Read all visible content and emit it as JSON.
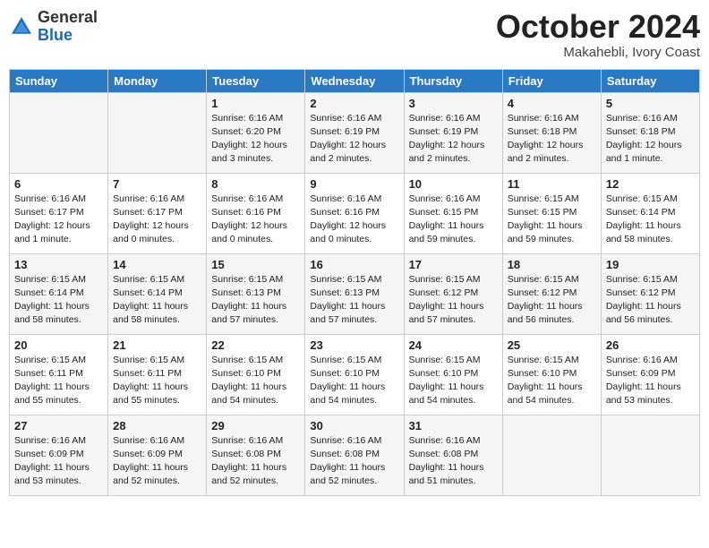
{
  "header": {
    "logo_general": "General",
    "logo_blue": "Blue",
    "month": "October 2024",
    "location": "Makahebli, Ivory Coast"
  },
  "days_of_week": [
    "Sunday",
    "Monday",
    "Tuesday",
    "Wednesday",
    "Thursday",
    "Friday",
    "Saturday"
  ],
  "weeks": [
    [
      {
        "day": "",
        "info": ""
      },
      {
        "day": "",
        "info": ""
      },
      {
        "day": "1",
        "info": "Sunrise: 6:16 AM\nSunset: 6:20 PM\nDaylight: 12 hours\nand 3 minutes."
      },
      {
        "day": "2",
        "info": "Sunrise: 6:16 AM\nSunset: 6:19 PM\nDaylight: 12 hours\nand 2 minutes."
      },
      {
        "day": "3",
        "info": "Sunrise: 6:16 AM\nSunset: 6:19 PM\nDaylight: 12 hours\nand 2 minutes."
      },
      {
        "day": "4",
        "info": "Sunrise: 6:16 AM\nSunset: 6:18 PM\nDaylight: 12 hours\nand 2 minutes."
      },
      {
        "day": "5",
        "info": "Sunrise: 6:16 AM\nSunset: 6:18 PM\nDaylight: 12 hours\nand 1 minute."
      }
    ],
    [
      {
        "day": "6",
        "info": "Sunrise: 6:16 AM\nSunset: 6:17 PM\nDaylight: 12 hours\nand 1 minute."
      },
      {
        "day": "7",
        "info": "Sunrise: 6:16 AM\nSunset: 6:17 PM\nDaylight: 12 hours\nand 0 minutes."
      },
      {
        "day": "8",
        "info": "Sunrise: 6:16 AM\nSunset: 6:16 PM\nDaylight: 12 hours\nand 0 minutes."
      },
      {
        "day": "9",
        "info": "Sunrise: 6:16 AM\nSunset: 6:16 PM\nDaylight: 12 hours\nand 0 minutes."
      },
      {
        "day": "10",
        "info": "Sunrise: 6:16 AM\nSunset: 6:15 PM\nDaylight: 11 hours\nand 59 minutes."
      },
      {
        "day": "11",
        "info": "Sunrise: 6:15 AM\nSunset: 6:15 PM\nDaylight: 11 hours\nand 59 minutes."
      },
      {
        "day": "12",
        "info": "Sunrise: 6:15 AM\nSunset: 6:14 PM\nDaylight: 11 hours\nand 58 minutes."
      }
    ],
    [
      {
        "day": "13",
        "info": "Sunrise: 6:15 AM\nSunset: 6:14 PM\nDaylight: 11 hours\nand 58 minutes."
      },
      {
        "day": "14",
        "info": "Sunrise: 6:15 AM\nSunset: 6:14 PM\nDaylight: 11 hours\nand 58 minutes."
      },
      {
        "day": "15",
        "info": "Sunrise: 6:15 AM\nSunset: 6:13 PM\nDaylight: 11 hours\nand 57 minutes."
      },
      {
        "day": "16",
        "info": "Sunrise: 6:15 AM\nSunset: 6:13 PM\nDaylight: 11 hours\nand 57 minutes."
      },
      {
        "day": "17",
        "info": "Sunrise: 6:15 AM\nSunset: 6:12 PM\nDaylight: 11 hours\nand 57 minutes."
      },
      {
        "day": "18",
        "info": "Sunrise: 6:15 AM\nSunset: 6:12 PM\nDaylight: 11 hours\nand 56 minutes."
      },
      {
        "day": "19",
        "info": "Sunrise: 6:15 AM\nSunset: 6:12 PM\nDaylight: 11 hours\nand 56 minutes."
      }
    ],
    [
      {
        "day": "20",
        "info": "Sunrise: 6:15 AM\nSunset: 6:11 PM\nDaylight: 11 hours\nand 55 minutes."
      },
      {
        "day": "21",
        "info": "Sunrise: 6:15 AM\nSunset: 6:11 PM\nDaylight: 11 hours\nand 55 minutes."
      },
      {
        "day": "22",
        "info": "Sunrise: 6:15 AM\nSunset: 6:10 PM\nDaylight: 11 hours\nand 54 minutes."
      },
      {
        "day": "23",
        "info": "Sunrise: 6:15 AM\nSunset: 6:10 PM\nDaylight: 11 hours\nand 54 minutes."
      },
      {
        "day": "24",
        "info": "Sunrise: 6:15 AM\nSunset: 6:10 PM\nDaylight: 11 hours\nand 54 minutes."
      },
      {
        "day": "25",
        "info": "Sunrise: 6:15 AM\nSunset: 6:10 PM\nDaylight: 11 hours\nand 54 minutes."
      },
      {
        "day": "26",
        "info": "Sunrise: 6:16 AM\nSunset: 6:09 PM\nDaylight: 11 hours\nand 53 minutes."
      }
    ],
    [
      {
        "day": "27",
        "info": "Sunrise: 6:16 AM\nSunset: 6:09 PM\nDaylight: 11 hours\nand 53 minutes."
      },
      {
        "day": "28",
        "info": "Sunrise: 6:16 AM\nSunset: 6:09 PM\nDaylight: 11 hours\nand 52 minutes."
      },
      {
        "day": "29",
        "info": "Sunrise: 6:16 AM\nSunset: 6:08 PM\nDaylight: 11 hours\nand 52 minutes."
      },
      {
        "day": "30",
        "info": "Sunrise: 6:16 AM\nSunset: 6:08 PM\nDaylight: 11 hours\nand 52 minutes."
      },
      {
        "day": "31",
        "info": "Sunrise: 6:16 AM\nSunset: 6:08 PM\nDaylight: 11 hours\nand 51 minutes."
      },
      {
        "day": "",
        "info": ""
      },
      {
        "day": "",
        "info": ""
      }
    ]
  ]
}
